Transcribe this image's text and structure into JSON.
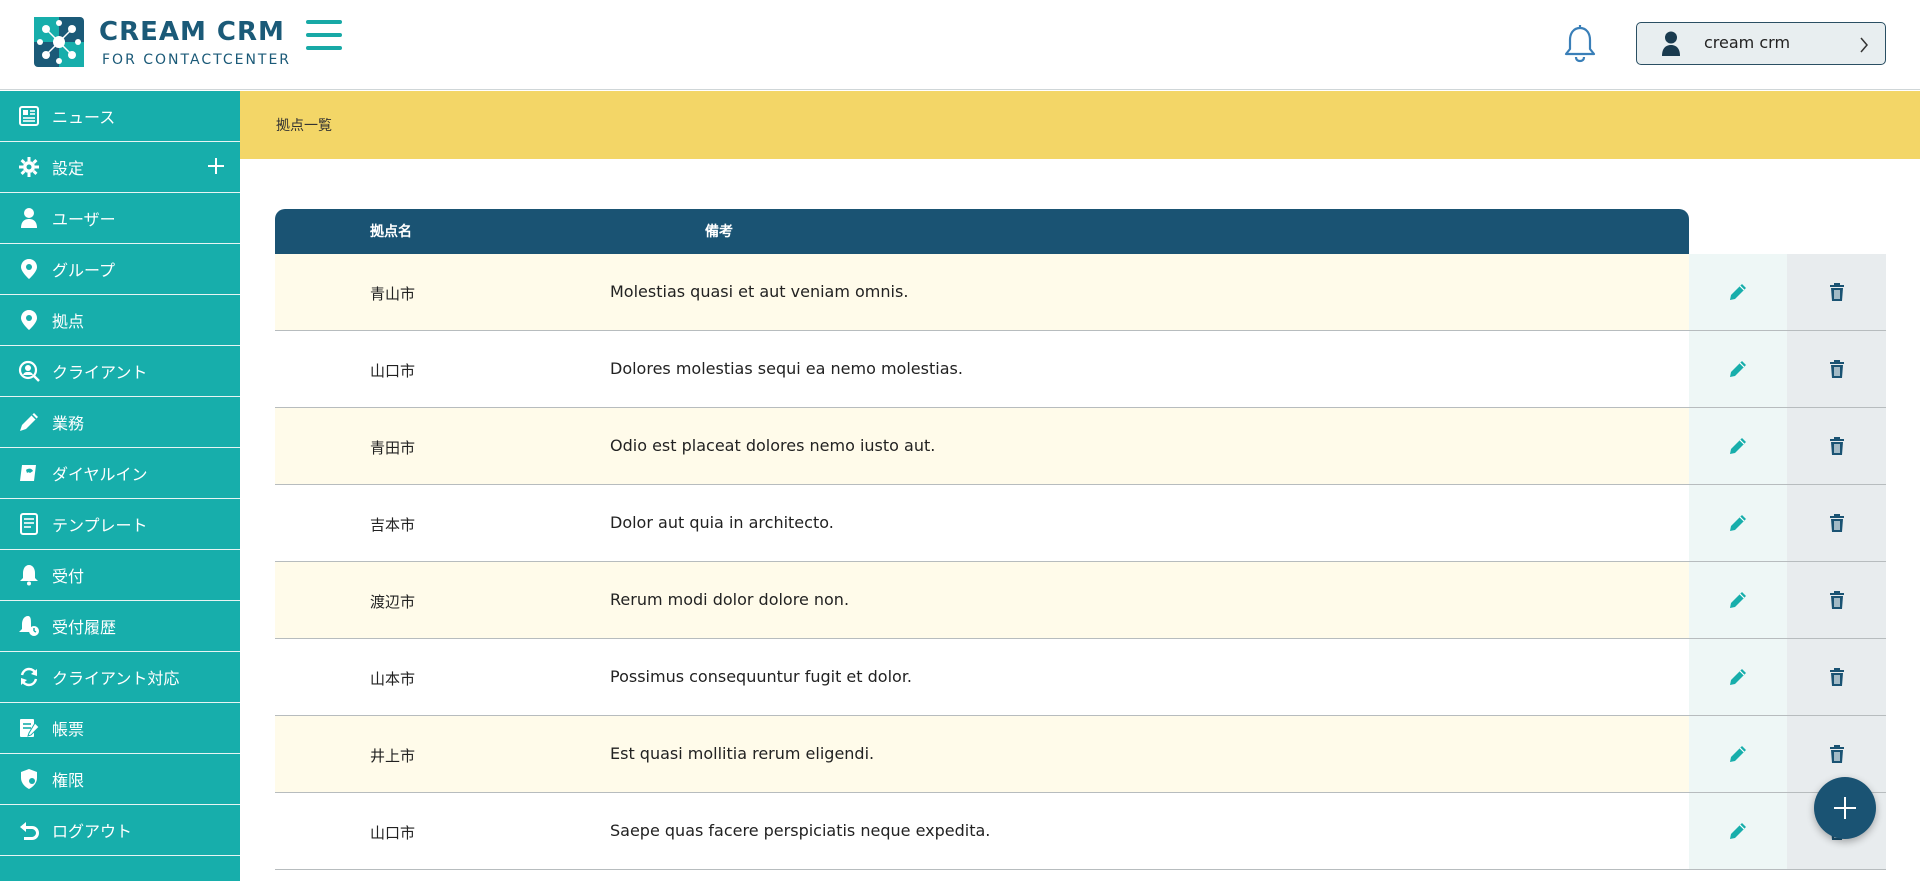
{
  "header": {
    "brand_title": "CREAM CRM",
    "brand_subtitle": "FOR CONTACTCENTER",
    "user_name": "cream crm"
  },
  "sidebar": {
    "items": [
      {
        "label": "ニュース",
        "icon": "newspaper-icon"
      },
      {
        "label": "設定",
        "icon": "gear-icon",
        "expandable": true
      },
      {
        "label": "ユーザー",
        "icon": "user-icon"
      },
      {
        "label": "グループ",
        "icon": "map-pin-icon"
      },
      {
        "label": "拠点",
        "icon": "map-pin-icon"
      },
      {
        "label": "クライアント",
        "icon": "client-search-icon"
      },
      {
        "label": "業務",
        "icon": "pen-icon"
      },
      {
        "label": "ダイヤルイン",
        "icon": "dial-in-icon"
      },
      {
        "label": "テンプレート",
        "icon": "document-icon"
      },
      {
        "label": "受付",
        "icon": "bell-icon"
      },
      {
        "label": "受付履歴",
        "icon": "bell-history-icon"
      },
      {
        "label": "クライアント対応",
        "icon": "sync-icon"
      },
      {
        "label": "帳票",
        "icon": "report-icon"
      },
      {
        "label": "権限",
        "icon": "shield-icon"
      },
      {
        "label": "ログアウト",
        "icon": "logout-icon"
      }
    ]
  },
  "breadcrumb": "拠点一覧",
  "table": {
    "headers": {
      "name": "拠点名",
      "note": "備考"
    },
    "rows": [
      {
        "name": "青山市",
        "note": "Molestias quasi et aut veniam omnis."
      },
      {
        "name": "山口市",
        "note": "Dolores molestias sequi ea nemo molestias."
      },
      {
        "name": "青田市",
        "note": "Odio est placeat dolores nemo iusto aut."
      },
      {
        "name": "吉本市",
        "note": "Dolor aut quia in architecto."
      },
      {
        "name": "渡辺市",
        "note": "Rerum modi dolor dolore non."
      },
      {
        "name": "山本市",
        "note": "Possimus consequuntur fugit et dolor."
      },
      {
        "name": "井上市",
        "note": "Est quasi mollitia rerum eligendi."
      },
      {
        "name": "山口市",
        "note": "Saepe quas facere perspiciatis neque expedita."
      }
    ]
  },
  "colors": {
    "sidebar": "#17aeab",
    "table_header": "#1a5373",
    "breadcrumb_band": "#f3d667",
    "row_alt": "#fffbea"
  }
}
